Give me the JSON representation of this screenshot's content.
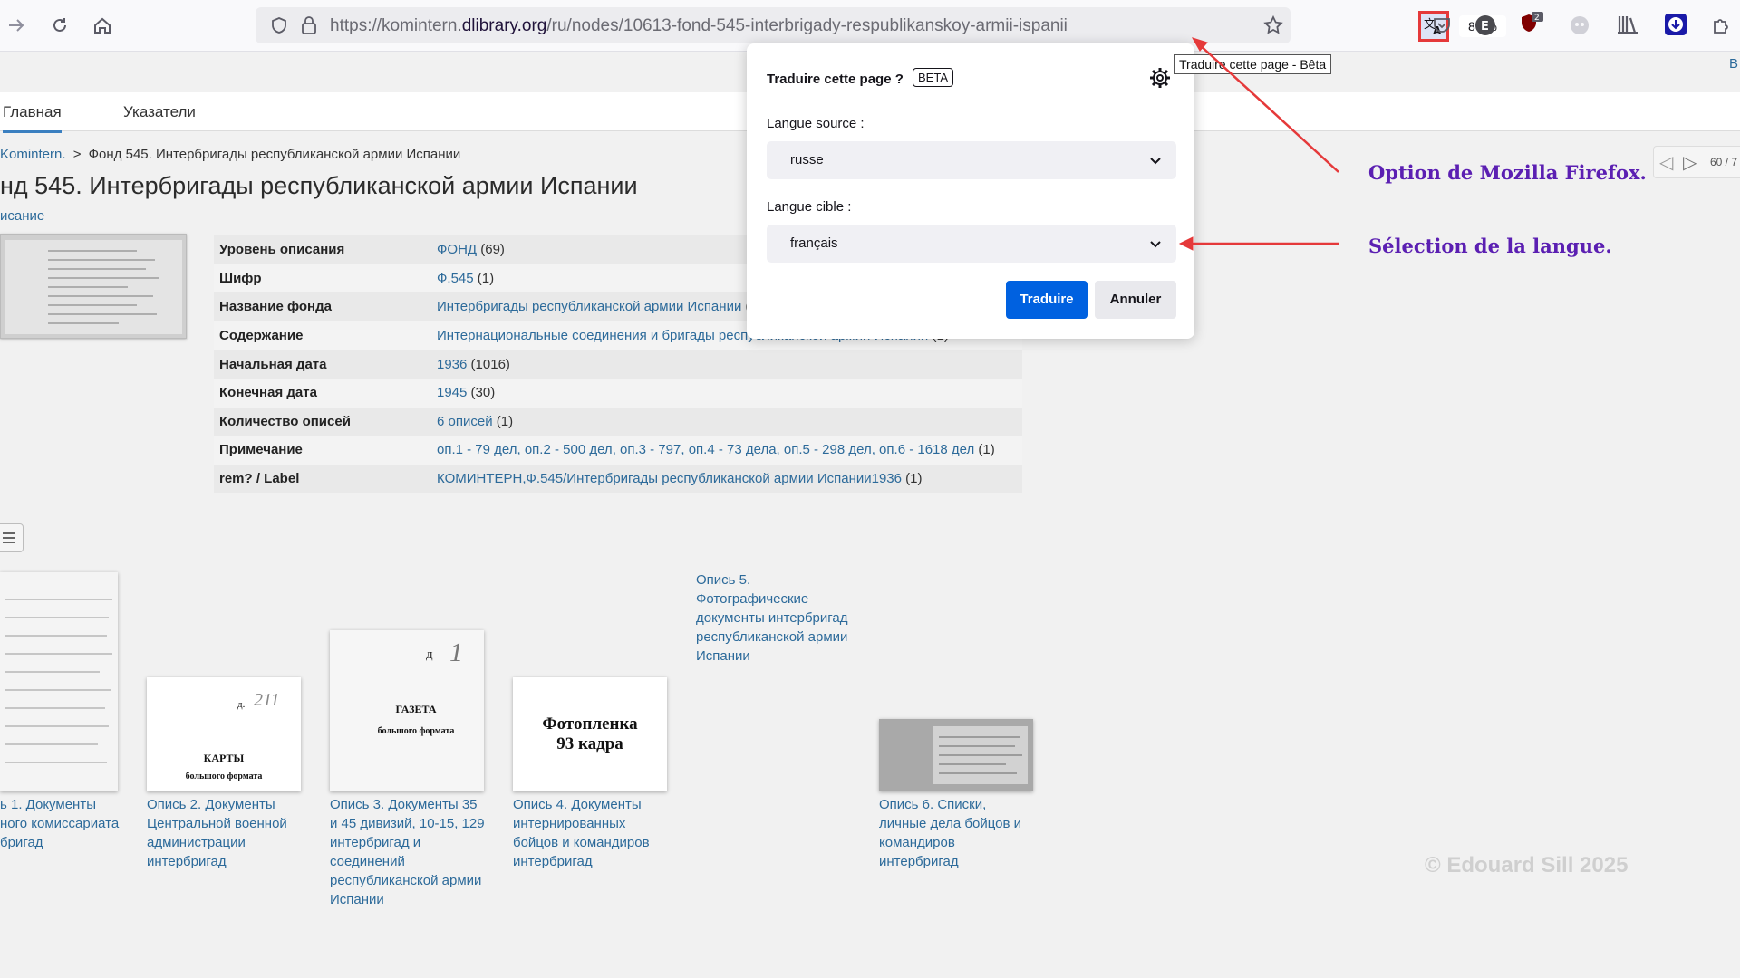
{
  "browser": {
    "url_prefix": "https://komintern.",
    "url_domain": "dlibrary.org",
    "url_path": "/ru/nodes/10613-fond-545-interbrigady-respublikanskoy-armii-ispanii",
    "zoom": "80 %",
    "tooltip": "Traduire cette page - Bêta"
  },
  "site": {
    "nav": {
      "main": "Главная",
      "index": "Указатели"
    },
    "breadcrumb": {
      "root": "Komintern.",
      "sep": ">",
      "current": "Фонд 545. Интербригады республиканской армии Испании"
    },
    "title": "нд 545. Интербригады республиканской армии Испании",
    "description_link": "исание",
    "top_right_letter": "B",
    "pager": "60 / 7",
    "meta_rows": [
      {
        "key": "Уровень описания",
        "value": "ФОНД",
        "count": "(69)"
      },
      {
        "key": "Шифр",
        "value": "Ф.545",
        "count": "(1)"
      },
      {
        "key": "Название фонда",
        "value": "Интербригады республиканской армии Испании",
        "count": "("
      },
      {
        "key": "Содержание",
        "value": "Интернациональные соединения и бригады республиканской армии Испании",
        "count": "(1)"
      },
      {
        "key": "Начальная дата",
        "value": "1936",
        "count": "(1016)"
      },
      {
        "key": "Конечная дата",
        "value": "1945",
        "count": "(30)"
      },
      {
        "key": "Количество описей",
        "value": "6 описей",
        "count": "(1)"
      },
      {
        "key": "Примечание",
        "value": "оп.1 - 79 дел, оп.2 - 500 дел, оп.3 - 797, оп.4 - 73 дела, оп.5 - 298 дел, оп.6 - 1618 дел",
        "count": "(1)"
      },
      {
        "key": "rem? / Label",
        "value": "КОМИНТЕРН,Ф.545/Интербригады республиканской армии Испании1936",
        "count": "(1)"
      }
    ],
    "cards": [
      {
        "caption": [
          "ь 1. Документы",
          "ного комиссариата",
          "бригад"
        ]
      },
      {
        "caption": [
          "Опись 2. Документы",
          "Центральной военной",
          "администрации",
          "интербригад"
        ],
        "img_lines": [
          "д.",
          "211",
          "КАРТЫ",
          "большого формата"
        ]
      },
      {
        "caption": [
          "Опись 3. Документы 35",
          "и 45 дивизий, 10-15, 129",
          "интербригад и",
          "соединений",
          "республиканской армии",
          "Испании"
        ],
        "img_lines": [
          "Д",
          "1",
          "ГАЗЕТА",
          "большого формата"
        ]
      },
      {
        "caption": [
          "Опись 4. Документы",
          "интернированных",
          "бойцов и командиров",
          "интербригад"
        ],
        "img_lines": [
          "Фотопленка",
          "93 кадра"
        ]
      },
      {
        "caption": [
          "Опись 5.",
          "Фотографические",
          "документы интербригад",
          "республиканской армии",
          "Испании"
        ]
      },
      {
        "caption": [
          "Опись 6. Списки,",
          "личные дела бойцов и",
          "командиров",
          "интербригад"
        ]
      }
    ]
  },
  "translate_panel": {
    "title": "Traduire cette page ?",
    "beta": "BETA",
    "source_label": "Langue source :",
    "source_value": "russe",
    "target_label": "Langue cible :",
    "target_value": "français",
    "translate_button": "Traduire",
    "cancel_button": "Annuler"
  },
  "annotations": {
    "option": "Option de Mozilla Firefox.",
    "selection": "Sélection de la langue.",
    "copyright": "© Edouard Sill 2025",
    "color": "#5b1fb2",
    "arrow_color": "#e5393a"
  },
  "icons": [
    "back-arrow-icon",
    "reload-icon",
    "home-icon",
    "shield-icon",
    "lock-icon",
    "translate-icon",
    "star-icon",
    "pocket-icon",
    "extension-e-icon",
    "ublock-icon",
    "ghost-icon",
    "library-icon",
    "download-icon",
    "extensions-puzzle-icon",
    "gear-icon",
    "chevron-down-icon"
  ]
}
